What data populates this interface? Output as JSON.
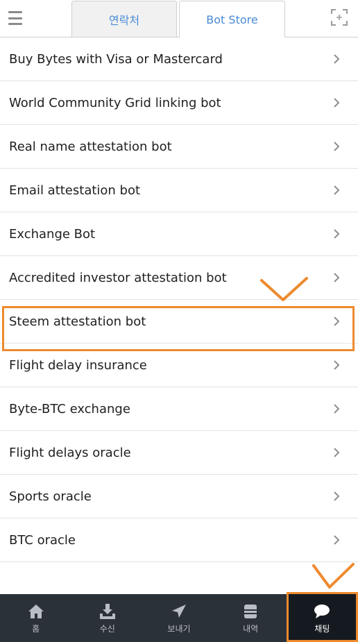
{
  "header": {
    "tabs": [
      {
        "label": "연락처",
        "active": false
      },
      {
        "label": "Bot Store",
        "active": true
      }
    ]
  },
  "bot_list": [
    {
      "label": "Buy Bytes with Visa or Mastercard"
    },
    {
      "label": "World Community Grid linking bot"
    },
    {
      "label": "Real name attestation bot"
    },
    {
      "label": "Email attestation bot"
    },
    {
      "label": "Exchange Bot"
    },
    {
      "label": "Accredited investor attestation bot"
    },
    {
      "label": "Steem attestation bot"
    },
    {
      "label": "Flight delay insurance"
    },
    {
      "label": "Byte-BTC exchange"
    },
    {
      "label": "Flight delays oracle"
    },
    {
      "label": "Sports oracle"
    },
    {
      "label": "BTC oracle"
    }
  ],
  "bottom_nav": [
    {
      "label": "홈",
      "icon": "home-icon"
    },
    {
      "label": "수신",
      "icon": "receive-icon"
    },
    {
      "label": "보내기",
      "icon": "send-icon"
    },
    {
      "label": "내역",
      "icon": "history-icon"
    },
    {
      "label": "채팅",
      "icon": "chat-icon",
      "active": true
    }
  ],
  "colors": {
    "accent_blue": "#4a8bd6",
    "annotation_orange": "#ed8a2e",
    "nav_background": "#2b3139",
    "nav_active_background": "#151a20"
  }
}
